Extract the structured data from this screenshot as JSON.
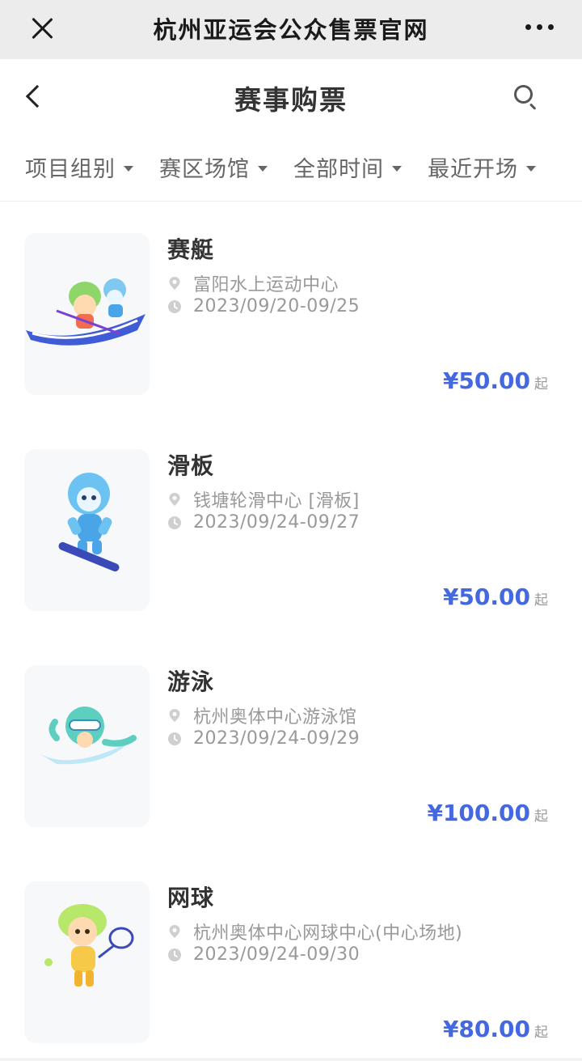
{
  "wechat_bar": {
    "title": "杭州亚运会公众售票官网"
  },
  "header": {
    "title": "赛事购票"
  },
  "filters": [
    {
      "label": "项目组别"
    },
    {
      "label": "赛区场馆"
    },
    {
      "label": "全部时间"
    },
    {
      "label": "最近开场"
    }
  ],
  "colors": {
    "accent": "#4468e0",
    "muted": "#999999",
    "title": "#333333"
  },
  "events": [
    {
      "name": "赛艇",
      "venue": "富阳水上运动中心",
      "date": "2023/09/20-09/25",
      "price": "¥50.00",
      "price_suffix": "起",
      "mascot": "rowing-mascots"
    },
    {
      "name": "滑板",
      "venue": "钱塘轮滑中心 [滑板]",
      "date": "2023/09/24-09/27",
      "price": "¥50.00",
      "price_suffix": "起",
      "mascot": "skateboard-mascot"
    },
    {
      "name": "游泳",
      "venue": "杭州奥体中心游泳馆",
      "date": "2023/09/24-09/29",
      "price": "¥100.00",
      "price_suffix": "起",
      "mascot": "swimming-mascot"
    },
    {
      "name": "网球",
      "venue": "杭州奥体中心网球中心(中心场地)",
      "date": "2023/09/24-09/30",
      "price": "¥80.00",
      "price_suffix": "起",
      "mascot": "tennis-mascot"
    }
  ]
}
